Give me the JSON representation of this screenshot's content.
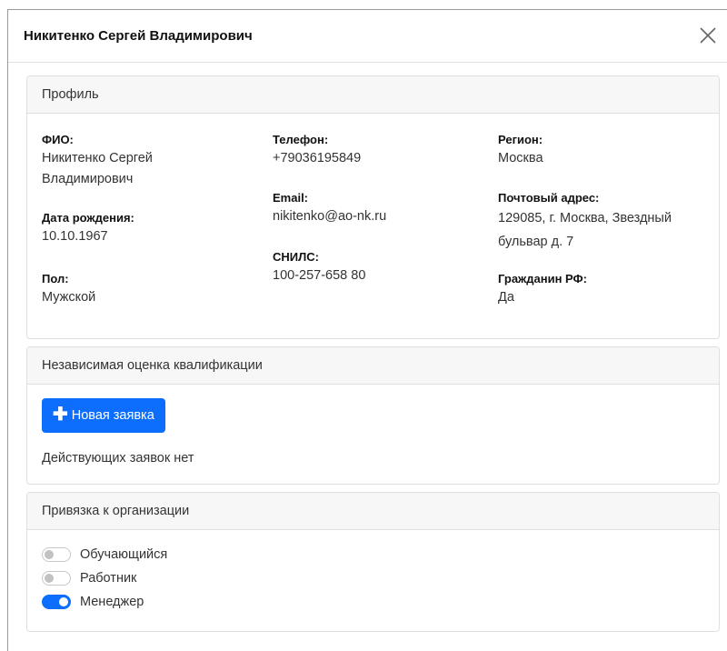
{
  "modal": {
    "title": "Никитенко Сергей Владимирович"
  },
  "profile": {
    "header": "Профиль",
    "fio_label": "ФИО:",
    "fio_value": "Никитенко Сергей Владимирович",
    "birth_label": "Дата рождения:",
    "birth_value": "10.10.1967",
    "gender_label": "Пол:",
    "gender_value": "Мужской",
    "phone_label": "Телефон:",
    "phone_value": "+79036195849",
    "email_label": "Email:",
    "email_value": "nikitenko@ao-nk.ru",
    "snils_label": "СНИЛС:",
    "snils_value": "100-257-658 80",
    "region_label": "Регион:",
    "region_value": "Москва",
    "address_label": "Почтовый адрес:",
    "address_value": "129085, г. Москва, Звездный бульвар д. 7",
    "citizen_label": "Гражданин РФ:",
    "citizen_value": "Да"
  },
  "assessment": {
    "header": "Независимая оценка квалификации",
    "new_button_label": "Новая заявка",
    "empty_text": "Действующих заявок нет"
  },
  "organization": {
    "header": "Привязка к организации",
    "roles": [
      {
        "label": "Обучающийся",
        "checked": false
      },
      {
        "label": "Работник",
        "checked": false
      },
      {
        "label": "Менеджер",
        "checked": true
      }
    ]
  },
  "colors": {
    "primary": "#0d6efd",
    "card_header_bg": "#f7f7f7"
  }
}
